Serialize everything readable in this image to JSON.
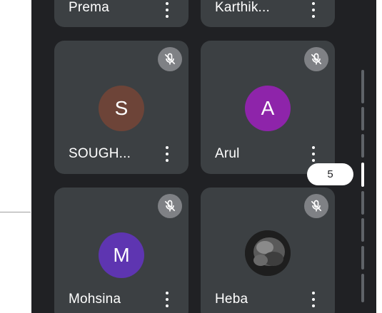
{
  "participants": [
    {
      "name": "Prema",
      "muted": true
    },
    {
      "name": "Karthik...",
      "muted": true
    },
    {
      "name": "SOUGH...",
      "initial": "S",
      "avatar_color": "#6d4438",
      "muted": true
    },
    {
      "name": "Arul",
      "initial": "A",
      "avatar_color": "#8e24aa",
      "muted": true
    },
    {
      "name": "Mohsina",
      "initial": "M",
      "avatar_color": "#5e35b1",
      "muted": true
    },
    {
      "name": "Heba",
      "muted": true
    }
  ],
  "icons": {
    "mute": "mic-off-icon",
    "more": "more-vert-icon"
  },
  "pager": {
    "page": "5"
  },
  "colors": {
    "background": "#202124",
    "tile": "#3c4043",
    "mute_badge": "#7f8185"
  }
}
